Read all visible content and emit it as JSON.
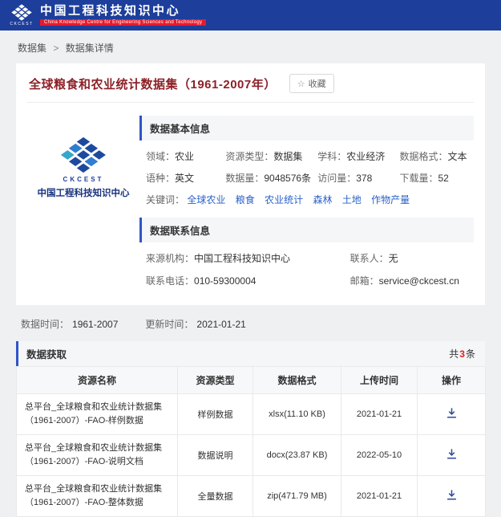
{
  "header": {
    "site_title": "中国工程科技知识中心",
    "site_subtitle": "China Knowledge Centre for Engineering Sciences and Technology",
    "logo_text": "CKCEST"
  },
  "breadcrumb": {
    "parent": "数据集",
    "separator": ">",
    "current": "数据集详情"
  },
  "icons": {
    "favorite_star": "☆"
  },
  "dataset": {
    "title": "全球粮食和农业统计数据集（1961-2007年）",
    "favorite_label": "收藏",
    "logo_brand": "CKCEST",
    "logo_caption": "中国工程科技知识中心",
    "basic_info": {
      "section_title": "数据基本信息",
      "fields": [
        {
          "label": "领域：",
          "value": "农业"
        },
        {
          "label": "资源类型：",
          "value": "数据集"
        },
        {
          "label": "学科：",
          "value": "农业经济"
        },
        {
          "label": "数据格式：",
          "value": "文本"
        },
        {
          "label": "语种：",
          "value": "英文"
        },
        {
          "label": "数据量：",
          "value": "9048576条"
        },
        {
          "label": "访问量：",
          "value": "378"
        },
        {
          "label": "下载量：",
          "value": "52"
        }
      ],
      "keywords_label": "关键词：",
      "keywords": [
        "全球农业",
        "粮食",
        "农业统计",
        "森林",
        "土地",
        "作物产量"
      ]
    },
    "contact_info": {
      "section_title": "数据联系信息",
      "fields": [
        {
          "label": "来源机构：",
          "value": "中国工程科技知识中心"
        },
        {
          "label": "联系人：",
          "value": "无"
        },
        {
          "label": "联系电话：",
          "value": "010-59300004"
        },
        {
          "label": "邮箱：",
          "value": "service@ckcest.cn"
        }
      ]
    },
    "meta": {
      "time_label": "数据时间：",
      "time_value": "1961-2007",
      "update_label": "更新时间：",
      "update_value": "2021-01-21"
    }
  },
  "acquisition": {
    "section_title": "数据获取",
    "total_prefix": "共",
    "total_count": "3",
    "total_suffix": "条",
    "table": {
      "headers": [
        "资源名称",
        "资源类型",
        "数据格式",
        "上传时间",
        "操作"
      ],
      "rows": [
        {
          "name": "总平台_全球粮食和农业统计数据集（1961-2007）-FAO-样例数据",
          "type": "样例数据",
          "format": "xlsx(11.10 KB)",
          "upload_time": "2021-01-21"
        },
        {
          "name": "总平台_全球粮食和农业统计数据集（1961-2007）-FAO-说明文档",
          "type": "数据说明",
          "format": "docx(23.87 KB)",
          "upload_time": "2022-05-10"
        },
        {
          "name": "总平台_全球粮食和农业统计数据集（1961-2007）-FAO-整体数据",
          "type": "全量数据",
          "format": "zip(471.79 MB)",
          "upload_time": "2021-01-21"
        }
      ]
    }
  },
  "colors": {
    "header_bg": "#1d3e9b",
    "banner_red": "#e8192c",
    "accent_blue": "#2f54c9",
    "link_blue": "#2a62c9",
    "title_maroon": "#8c2127",
    "count_red": "#e01f1f"
  }
}
